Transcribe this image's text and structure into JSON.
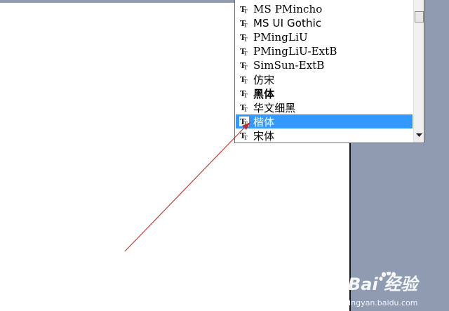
{
  "font_list": {
    "items": [
      {
        "label": "MS PMincho",
        "style": "serif"
      },
      {
        "label": "MS UI Gothic",
        "style": "sans"
      },
      {
        "label": "PMingLiU",
        "style": "serif"
      },
      {
        "label": "PMingLiU-ExtB",
        "style": "serif"
      },
      {
        "label": "SimSun-ExtB",
        "style": "serif"
      },
      {
        "label": "仿宋",
        "style": "serif"
      },
      {
        "label": "黑体",
        "style": "bold"
      },
      {
        "label": "华文细黑",
        "style": "sans"
      },
      {
        "label": "楷体",
        "style": "sans"
      },
      {
        "label": "宋体",
        "style": "sans"
      }
    ],
    "selected_label": "楷体",
    "icon": "truetype-font-icon"
  },
  "colors": {
    "selection": "#3399ff",
    "workspace": "#8e9bb1",
    "annotation_arrow": "#c03030"
  },
  "watermark": {
    "logo_text": "Bai 经验",
    "url": "jingyan.baidu.com"
  }
}
